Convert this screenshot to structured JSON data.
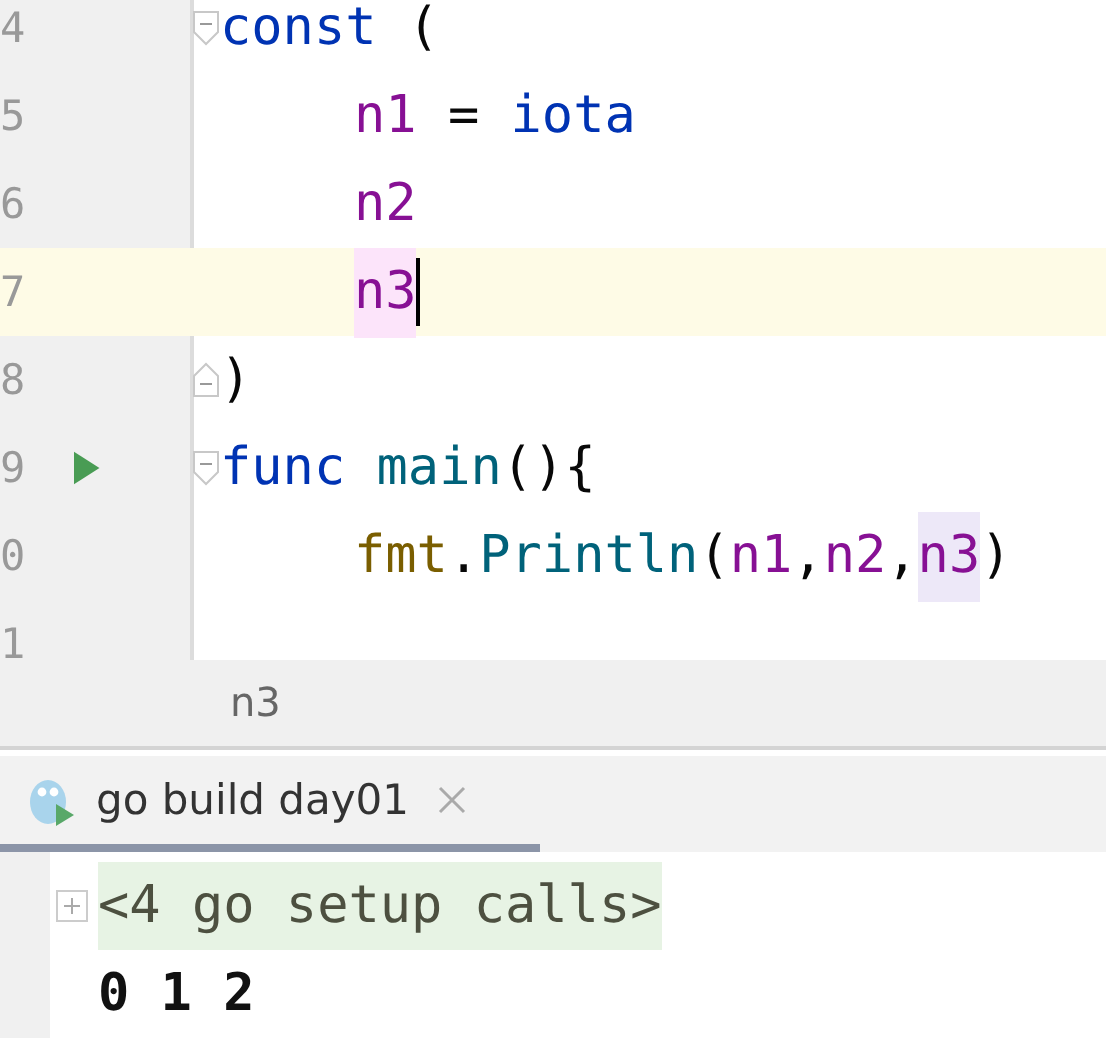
{
  "editor": {
    "lines": [
      {
        "number": "4",
        "fold_start": true,
        "fold_end": false,
        "run": false,
        "current": false,
        "indented": false,
        "caret": false,
        "tokens": [
          {
            "text": "const",
            "kind": "keyword",
            "highlighted": false
          },
          {
            "text": " (",
            "kind": "plain",
            "highlighted": false
          }
        ]
      },
      {
        "number": "5",
        "fold_start": false,
        "fold_end": false,
        "run": false,
        "current": false,
        "indented": true,
        "caret": false,
        "tokens": [
          {
            "text": "n1",
            "kind": "constant",
            "highlighted": false
          },
          {
            "text": " = ",
            "kind": "plain",
            "highlighted": false
          },
          {
            "text": "iota",
            "kind": "keyword",
            "highlighted": false
          }
        ]
      },
      {
        "number": "6",
        "fold_start": false,
        "fold_end": false,
        "run": false,
        "current": false,
        "indented": true,
        "caret": false,
        "tokens": [
          {
            "text": "n2",
            "kind": "constant",
            "highlighted": false
          }
        ]
      },
      {
        "number": "7",
        "fold_start": false,
        "fold_end": false,
        "run": false,
        "current": true,
        "indented": true,
        "caret": true,
        "tokens": [
          {
            "text": "n3",
            "kind": "constant",
            "highlighted": true
          }
        ]
      },
      {
        "number": "8",
        "fold_start": false,
        "fold_end": true,
        "run": false,
        "current": false,
        "indented": false,
        "caret": false,
        "tokens": [
          {
            "text": ")",
            "kind": "plain",
            "highlighted": false
          }
        ]
      },
      {
        "number": "9",
        "fold_start": true,
        "fold_end": false,
        "run": true,
        "current": false,
        "indented": false,
        "caret": false,
        "tokens": [
          {
            "text": "func ",
            "kind": "keyword",
            "highlighted": false
          },
          {
            "text": "main",
            "kind": "call",
            "highlighted": false
          },
          {
            "text": "(){",
            "kind": "plain",
            "highlighted": false
          }
        ]
      },
      {
        "number": "0",
        "fold_start": false,
        "fold_end": false,
        "run": false,
        "current": false,
        "indented": true,
        "caret": false,
        "tokens": [
          {
            "text": "fmt",
            "kind": "package",
            "highlighted": false
          },
          {
            "text": ".",
            "kind": "plain",
            "highlighted": false
          },
          {
            "text": "Println",
            "kind": "call",
            "highlighted": false
          },
          {
            "text": "(",
            "kind": "plain",
            "highlighted": false
          },
          {
            "text": "n1",
            "kind": "constant",
            "highlighted": false
          },
          {
            "text": ",",
            "kind": "plain",
            "highlighted": false
          },
          {
            "text": "n2",
            "kind": "constant",
            "highlighted": false
          },
          {
            "text": ",",
            "kind": "plain",
            "highlighted": false
          },
          {
            "text": "n3",
            "kind": "constant",
            "highlighted": true
          },
          {
            "text": ")",
            "kind": "plain",
            "highlighted": false
          }
        ]
      },
      {
        "number": "1",
        "fold_start": false,
        "fold_end": false,
        "run": false,
        "current": false
      }
    ]
  },
  "breadcrumb": "n3",
  "run_panel": {
    "tabs": [
      {
        "label": "go build day01",
        "selected": true
      }
    ],
    "output": [
      {
        "kind": "folded",
        "text": "<4 go setup calls>"
      },
      {
        "kind": "plain",
        "text": "0 1 2"
      }
    ]
  }
}
